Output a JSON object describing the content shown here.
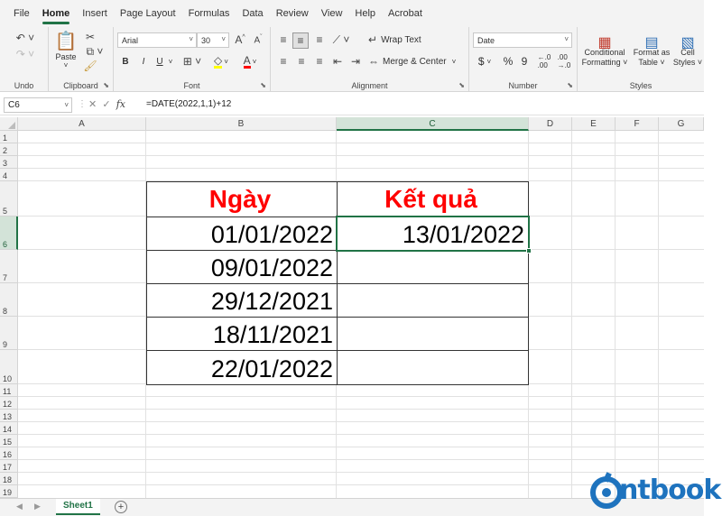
{
  "menu": {
    "items": [
      "File",
      "Home",
      "Insert",
      "Page Layout",
      "Formulas",
      "Data",
      "Review",
      "View",
      "Help",
      "Acrobat"
    ],
    "active": "Home"
  },
  "ribbon": {
    "undo": {
      "label": "Undo"
    },
    "clipboard": {
      "label": "Clipboard",
      "paste": "Paste"
    },
    "font": {
      "label": "Font",
      "name": "Arial",
      "size": "30",
      "bold": "B",
      "italic": "I",
      "underline": "U"
    },
    "alignment": {
      "label": "Alignment",
      "wrap": "Wrap Text",
      "merge": "Merge & Center"
    },
    "number": {
      "label": "Number",
      "format": "Date",
      "currency": "$",
      "percent": "%",
      "comma": "9"
    },
    "styles": {
      "label": "Styles",
      "conditional_1": "Conditional",
      "conditional_2": "Formatting",
      "format_table_1": "Format as",
      "format_table_2": "Table",
      "cell_styles_1": "Cell",
      "cell_styles_2": "Styles"
    }
  },
  "formula_bar": {
    "name_box": "C6",
    "fx": "fx",
    "formula": "=DATE(2022,1,1)+12"
  },
  "columns": [
    "A",
    "B",
    "C",
    "D",
    "E",
    "F",
    "G"
  ],
  "selected_column": "C",
  "rows": [
    "1",
    "2",
    "3",
    "4",
    "5",
    "6",
    "7",
    "8",
    "9",
    "10",
    "11",
    "12",
    "13",
    "14",
    "15",
    "16",
    "17",
    "18",
    "19"
  ],
  "selected_row": "6",
  "table": {
    "header_date": "Ngày",
    "header_result": "Kết quả",
    "dates": [
      "01/01/2022",
      "09/01/2022",
      "29/12/2021",
      "18/11/2021",
      "22/01/2022"
    ],
    "results": [
      "13/01/2022",
      "",
      "",
      "",
      ""
    ]
  },
  "sheets": {
    "active": "Sheet1",
    "add": "+"
  },
  "watermark": {
    "text": "ntbook"
  },
  "colors": {
    "accent": "#217346",
    "header_text": "#ff0000",
    "logo": "#1e73be"
  }
}
